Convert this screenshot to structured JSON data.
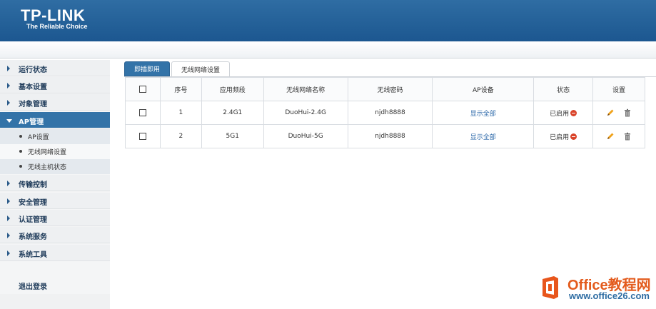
{
  "brand": {
    "logo": "TP-LINK",
    "tagline": "The Reliable Choice",
    "header_color": "#2466a0"
  },
  "sidebar": {
    "items": [
      {
        "label": "运行状态",
        "icon": "chevron-right-icon",
        "active": false
      },
      {
        "label": "基本设置",
        "icon": "chevron-right-icon",
        "active": false
      },
      {
        "label": "对象管理",
        "icon": "chevron-right-icon",
        "active": false
      },
      {
        "label": "AP管理",
        "icon": "chevron-down-icon",
        "active": true
      },
      {
        "label": "传输控制",
        "icon": "chevron-right-icon",
        "active": false
      },
      {
        "label": "安全管理",
        "icon": "chevron-right-icon",
        "active": false
      },
      {
        "label": "认证管理",
        "icon": "chevron-right-icon",
        "active": false
      },
      {
        "label": "系统服务",
        "icon": "chevron-right-icon",
        "active": false
      },
      {
        "label": "系统工具",
        "icon": "chevron-right-icon",
        "active": false
      }
    ],
    "subitems": [
      {
        "label": "AP设置"
      },
      {
        "label": "无线网络设置"
      },
      {
        "label": "无线主机状态"
      }
    ],
    "logout": "退出登录"
  },
  "tabs": [
    {
      "label": "即插即用",
      "active": true
    },
    {
      "label": "无线网络设置",
      "active": false
    }
  ],
  "table": {
    "headers": [
      "",
      "序号",
      "应用频段",
      "无线网络名称",
      "无线密码",
      "AP设备",
      "状态",
      "设置"
    ],
    "rows": [
      {
        "index": "1",
        "band": "2.4G1",
        "ssid": "DuoHui-2.4G",
        "password": "njdh8888",
        "ap": "显示全部",
        "status": "已启用"
      },
      {
        "index": "2",
        "band": "5G1",
        "ssid": "DuoHui-5G",
        "password": "njdh8888",
        "ap": "显示全部",
        "status": "已启用"
      }
    ]
  },
  "watermark": {
    "title": "Office教程网",
    "url": "www.office26.com"
  },
  "colors": {
    "accent": "#3373a8",
    "status_disable": "#d9442a",
    "link": "#2a67a8"
  }
}
